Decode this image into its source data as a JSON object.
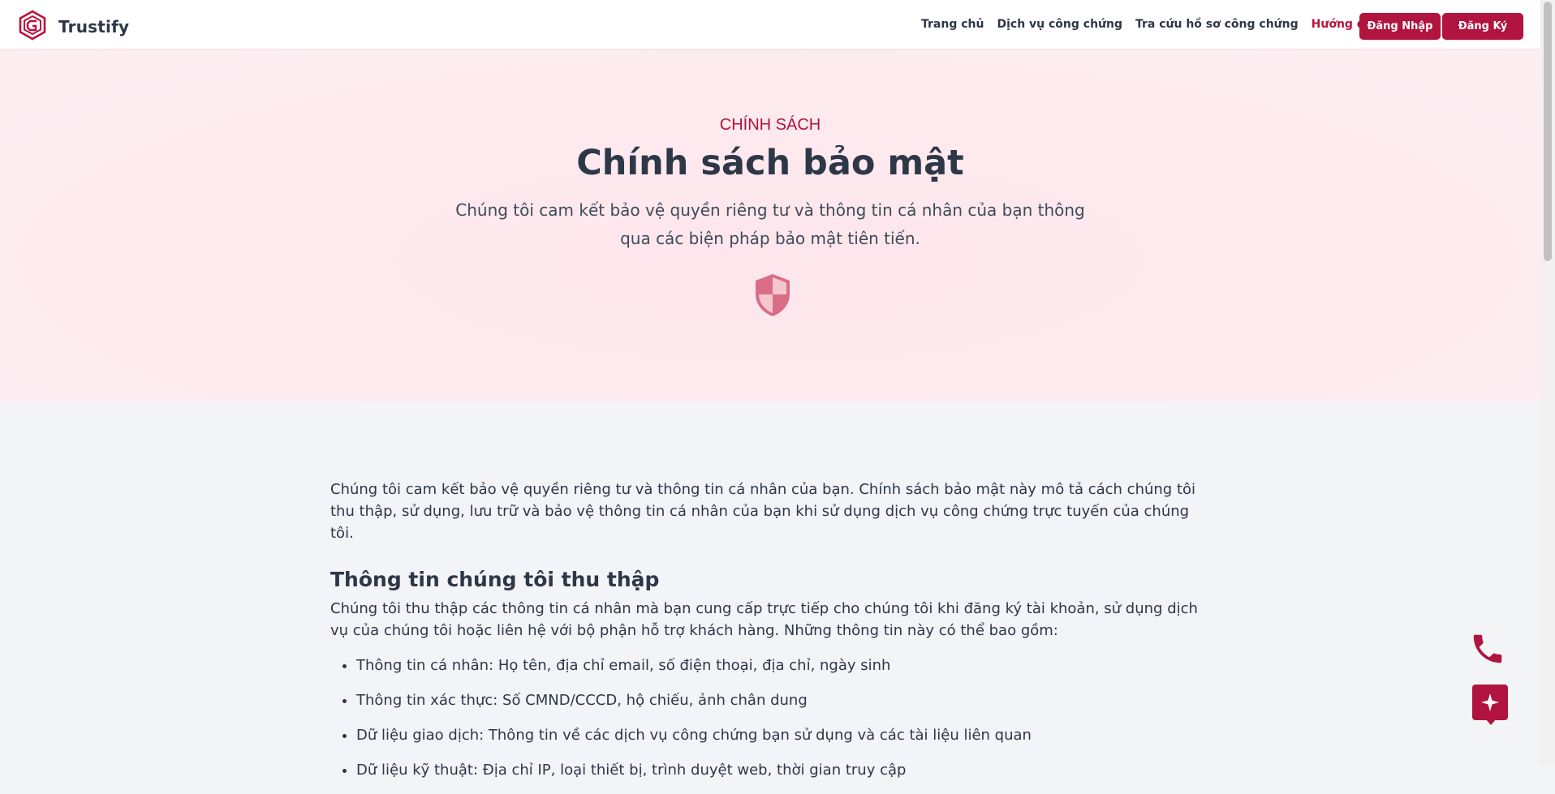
{
  "brand": {
    "name": "Trustify",
    "icon": "trustify-logo-icon",
    "color": "#be123c"
  },
  "nav": {
    "items": [
      {
        "label": "Trang chủ",
        "active": false
      },
      {
        "label": "Dịch vụ công chứng",
        "active": false
      },
      {
        "label": "Tra cứu hồ sơ công chứng",
        "active": false
      },
      {
        "label": "Hướng dẫn",
        "active": true
      }
    ],
    "login_label": "Đăng Nhập",
    "register_label": "Đăng Ký"
  },
  "hero": {
    "eyebrow": "CHÍNH SÁCH",
    "title": "Chính sách bảo mật",
    "subtitle": "Chúng tôi cam kết bảo vệ quyền riêng tư và thông tin cá nhân của bạn thông qua các biện pháp bảo mật tiên tiến.",
    "icon": "shield-icon"
  },
  "content": {
    "intro": "Chúng tôi cam kết bảo vệ quyền riêng tư và thông tin cá nhân của bạn. Chính sách bảo mật này mô tả cách chúng tôi thu thập, sử dụng, lưu trữ và bảo vệ thông tin cá nhân của bạn khi sử dụng dịch vụ công chứng trực tuyến của chúng tôi.",
    "section_title": "Thông tin chúng tôi thu thập",
    "section_text": "Chúng tôi thu thập các thông tin cá nhân mà bạn cung cấp trực tiếp cho chúng tôi khi đăng ký tài khoản, sử dụng dịch vụ của chúng tôi hoặc liên hệ với bộ phận hỗ trợ khách hàng. Những thông tin này có thể bao gồm:",
    "items": [
      "Thông tin cá nhân: Họ tên, địa chỉ email, số điện thoại, địa chỉ, ngày sinh",
      "Thông tin xác thực: Số CMND/CCCD, hộ chiếu, ảnh chân dung",
      "Dữ liệu giao dịch: Thông tin về các dịch vụ công chứng bạn sử dụng và các tài liệu liên quan",
      "Dữ liệu kỹ thuật: Địa chỉ IP, loại thiết bị, trình duyệt web, thời gian truy cập"
    ]
  },
  "floating": {
    "phone_icon": "phone-icon",
    "chat_icon": "sparkle-chat-icon"
  },
  "colors": {
    "accent": "#b0143f",
    "text": "#2d3748",
    "hero_bg": "#fde9ee"
  }
}
